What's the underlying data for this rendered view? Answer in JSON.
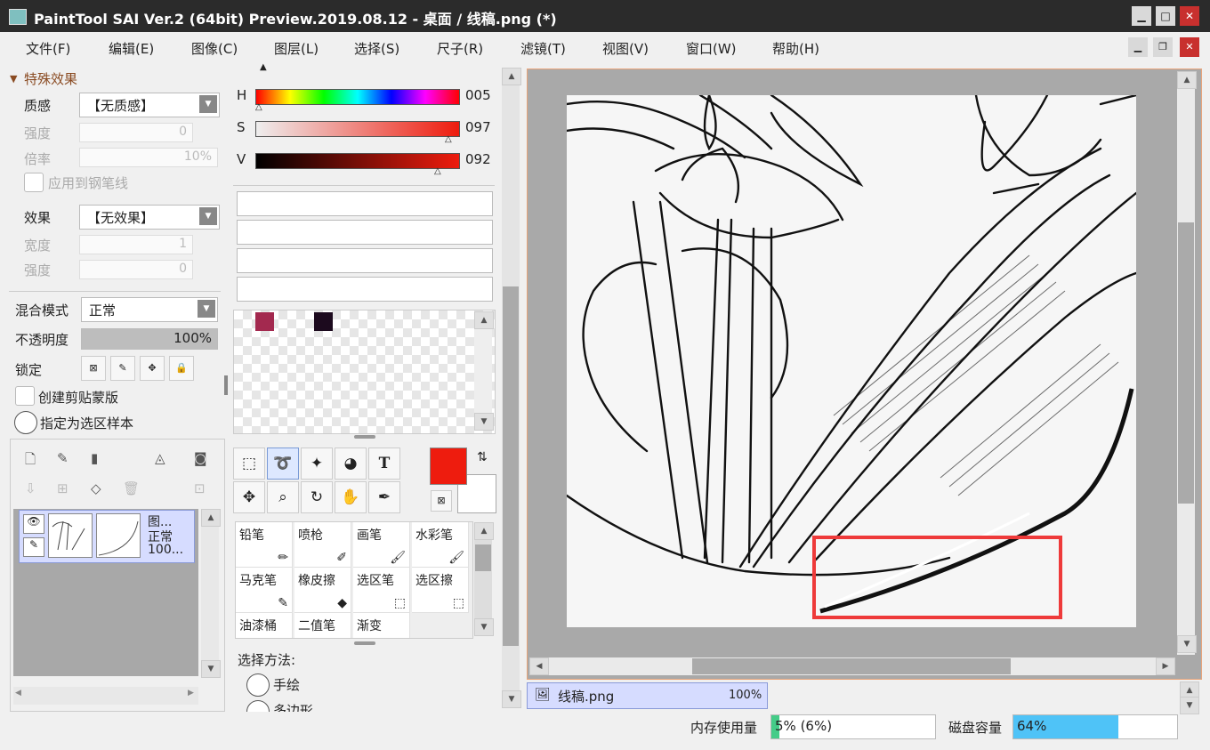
{
  "window": {
    "title": "PaintTool SAI Ver.2 (64bit) Preview.2019.08.12 - 桌面 / 线稿.png (*)"
  },
  "menu": [
    "文件(F)",
    "编辑(E)",
    "图像(C)",
    "图层(L)",
    "选择(S)",
    "尺子(R)",
    "滤镜(T)",
    "视图(V)",
    "窗口(W)",
    "帮助(H)"
  ],
  "effects": {
    "section_title": "特殊效果",
    "texture_label": "质感",
    "texture_value": "【无质感】",
    "strength_label": "强度",
    "strength_value": "0",
    "scale_label": "倍率",
    "scale_value": "10%",
    "apply_pen_label": "应用到钢笔线",
    "effect_label": "效果",
    "effect_value": "【无效果】",
    "width_label": "宽度",
    "width_value": "1",
    "strength2_label": "强度",
    "strength2_value": "0"
  },
  "layer_props": {
    "blend_label": "混合模式",
    "blend_value": "正常",
    "opacity_label": "不透明度",
    "opacity_value": "100%",
    "opacity_fraction": 1.0,
    "lock_label": "锁定",
    "clip_label": "创建剪贴蒙版",
    "sel_source_label": "指定为选区样本"
  },
  "layer": {
    "name": "图...",
    "mode": "正常",
    "opacity": "100..."
  },
  "color": {
    "h_label": "H",
    "h_value": "005",
    "s_label": "S",
    "s_value": "097",
    "v_label": "V",
    "v_value": "092",
    "fg": "#ee1c0e",
    "bg": "#ffffff",
    "swatch1": "#a3294f",
    "swatch2": "#1c0a1e"
  },
  "brushes": [
    {
      "label": "铅笔",
      "icon": "pencil-icon"
    },
    {
      "label": "喷枪",
      "icon": "airbrush-icon"
    },
    {
      "label": "画笔",
      "icon": "brush-icon"
    },
    {
      "label": "水彩笔",
      "icon": "watercolor-icon"
    },
    {
      "label": "马克笔",
      "icon": "marker-icon"
    },
    {
      "label": "橡皮擦",
      "icon": "eraser-icon"
    },
    {
      "label": "选区笔",
      "icon": "selpen-icon"
    },
    {
      "label": "选区擦",
      "icon": "selerase-icon"
    },
    {
      "label": "油漆桶",
      "icon": "bucket-icon"
    },
    {
      "label": "二值笔",
      "icon": "binarypen-icon"
    },
    {
      "label": "渐变",
      "icon": "gradient-icon"
    }
  ],
  "tool_options": {
    "method_label": "选择方法:",
    "opt1": "手绘",
    "opt2": "多边形"
  },
  "doc_tab": {
    "name": "线稿.png",
    "zoom": "100%"
  },
  "status": {
    "mem_label": "内存使用量",
    "mem_value": "5% (6%)",
    "mem_fraction": 0.05,
    "disk_label": "磁盘容量",
    "disk_value": "64%",
    "disk_fraction": 0.64
  },
  "colors": {
    "accent": "#4fc3f7",
    "mem_fill": "#44cc88",
    "highlight_rect": "#ee3a3a"
  }
}
